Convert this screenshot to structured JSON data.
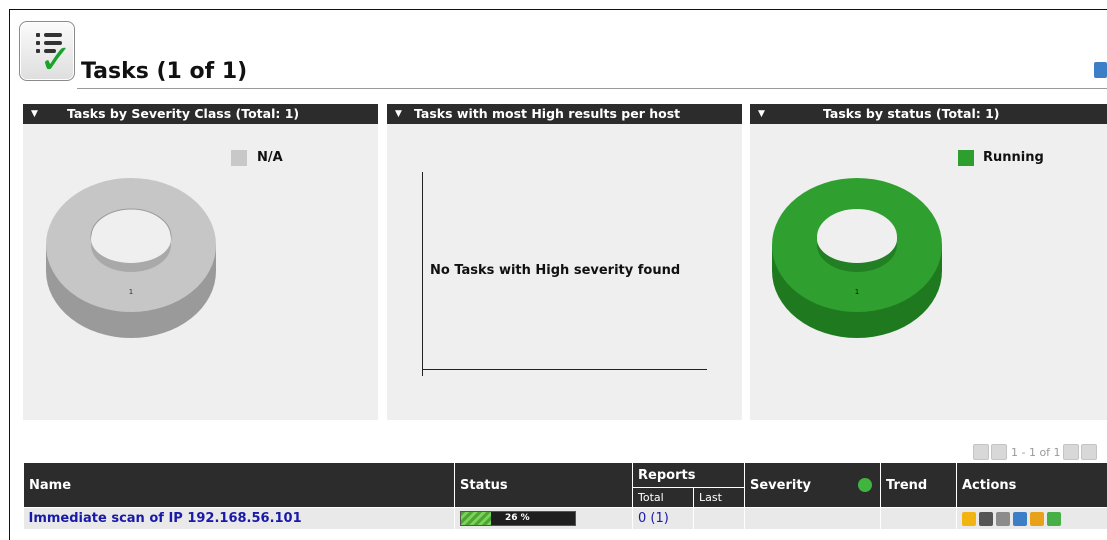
{
  "page": {
    "title": "Tasks (1 of 1)"
  },
  "panels": {
    "severity": {
      "title": "Tasks by Severity Class (Total: 1)",
      "legend": [
        {
          "label": "N/A",
          "color": "#c8c8c8"
        }
      ],
      "slice_label": "1"
    },
    "high": {
      "title": "Tasks with most High results per host",
      "empty_message": "No Tasks with High severity found"
    },
    "status": {
      "title": "Tasks by status (Total: 1)",
      "legend": [
        {
          "label": "Running",
          "color": "#2e9e2e"
        }
      ],
      "slice_label": "1"
    }
  },
  "pagination": {
    "text": "1 - 1 of 1"
  },
  "table": {
    "headers": {
      "name": "Name",
      "status": "Status",
      "reports": "Reports",
      "reports_total": "Total",
      "reports_last": "Last",
      "severity": "Severity",
      "trend": "Trend",
      "actions": "Actions"
    },
    "rows": [
      {
        "name": "Immediate scan of IP 192.168.56.101",
        "progress_percent": 26,
        "progress_label": "26 %",
        "reports_total": "0 (1)",
        "reports_last": "",
        "severity": "",
        "trend": ""
      }
    ]
  },
  "icons": {
    "task": "task-checklist-icon",
    "edit": "edit-icon",
    "stop": "stop-icon",
    "resume": "resume-icon",
    "delete": "trash-icon",
    "clone": "clone-icon",
    "export": "export-icon"
  }
}
